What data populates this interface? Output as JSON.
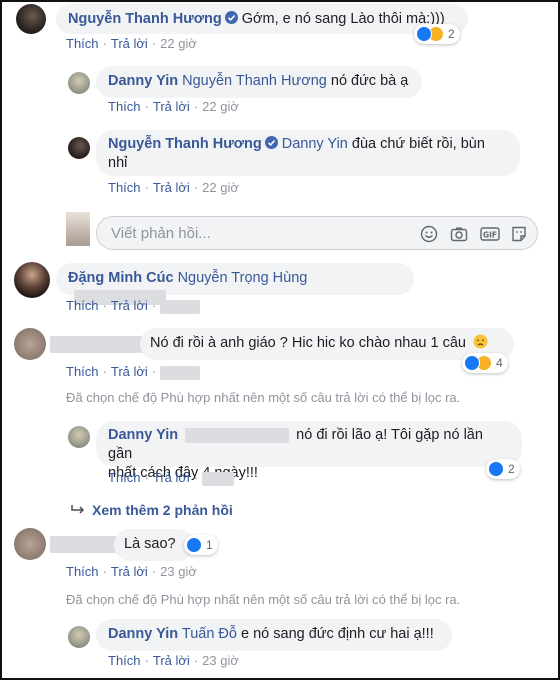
{
  "actions": {
    "like": "Thích",
    "reply": "Trả lời",
    "time_22h": "22 giờ",
    "time_23h": "23 giờ"
  },
  "comments": [
    {
      "author": "Nguyễn Thanh Hương",
      "text": "Gớm, e nó sang Lào thôi mà:)))",
      "reactions": "2"
    },
    {
      "author": "Danny Yin",
      "mention": "Nguyễn Thanh Hương",
      "text": "nó đức bà ạ"
    },
    {
      "author": "Nguyễn Thanh Hương",
      "mention": "Danny Yin",
      "text_line1": "đùa chứ biết rồi, bùn",
      "text_line2": "nhỉ"
    },
    {
      "author": "Đặng Minh Cúc",
      "mention": "Nguyễn Trọng Hùng"
    },
    {
      "text": "Nó đi rồi à anh giáo ? Hic hic ko chào nhau 1 câu",
      "emoji": "disappointed-face-icon",
      "reactions": "4"
    },
    {
      "author": "Danny Yin",
      "text_line1": "nó đi rồi lão ạ! Tôi gặp nó lần gần",
      "text_line2": "nhất cách đây 4 ngày!!!",
      "reactions": "2"
    },
    {
      "text": "Là sao?",
      "reactions": "1"
    },
    {
      "author": "Danny Yin",
      "mention": "Tuấn Đỗ",
      "text": "e nó sang đức định cư hai ạ!!!"
    }
  ],
  "reply_input": {
    "placeholder": "Viết phản hồi..."
  },
  "filter_notice": "Đã chọn chế độ Phù hợp nhất nên một số câu trả lời có thể bị lọc ra.",
  "more_replies": "Xem thêm 2 phản hồi",
  "colors": {
    "link": "#385898",
    "bubble": "#f2f3f5",
    "meta": "#90949c",
    "like": "#1877f2",
    "haha": "#f7b125"
  }
}
